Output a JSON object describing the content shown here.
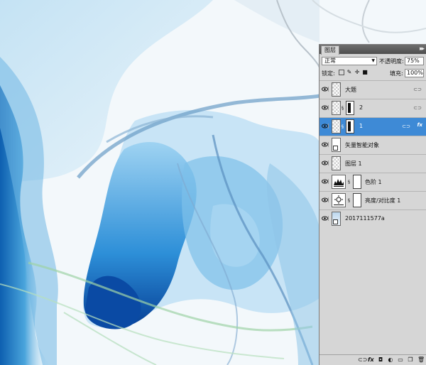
{
  "panel": {
    "tab_label": "图层",
    "collapse_glyph": "▸▸",
    "blend_mode": "正常",
    "opacity_label": "不透明度:",
    "opacity_value": "75%",
    "lock_label": "锁定:",
    "fill_label": "填充:",
    "fill_value": "100%"
  },
  "layers": [
    {
      "name": "大题",
      "thumb": "transparent",
      "mask": false,
      "linked": true,
      "selected": false
    },
    {
      "name": "2",
      "thumb": "transparent",
      "mask": true,
      "linked": true,
      "selected": false
    },
    {
      "name": "1",
      "thumb": "transparent",
      "mask": true,
      "linked": true,
      "fx": "fx",
      "selected": true
    },
    {
      "name": "矢量智能对象",
      "thumb": "doc",
      "mask": false,
      "linked": false,
      "selected": false
    },
    {
      "name": "图层 1",
      "thumb": "transparent",
      "mask": false,
      "linked": false,
      "selected": false
    },
    {
      "name": "色阶 1",
      "thumb": "levels",
      "mask": true,
      "linked": false,
      "selected": false
    },
    {
      "name": "亮度/对比度 1",
      "thumb": "brightness",
      "mask": true,
      "linked": false,
      "selected": false
    },
    {
      "name": "2017111577a",
      "thumb": "photo",
      "mask": false,
      "linked": false,
      "selected": false
    }
  ],
  "colors": {
    "selected_row": "#3e8ad6",
    "panel_bg": "#d6d6d6",
    "ink_dark": "#0b4fa0",
    "ink_mid": "#3a9bd8",
    "ink_light": "#a8d5ef",
    "ink_green": "#8fcf9a"
  },
  "bottom_icons": [
    "link-layers-icon",
    "fx-icon",
    "add-mask-icon",
    "adjustment-icon",
    "new-group-icon",
    "new-layer-icon",
    "trash-icon"
  ]
}
